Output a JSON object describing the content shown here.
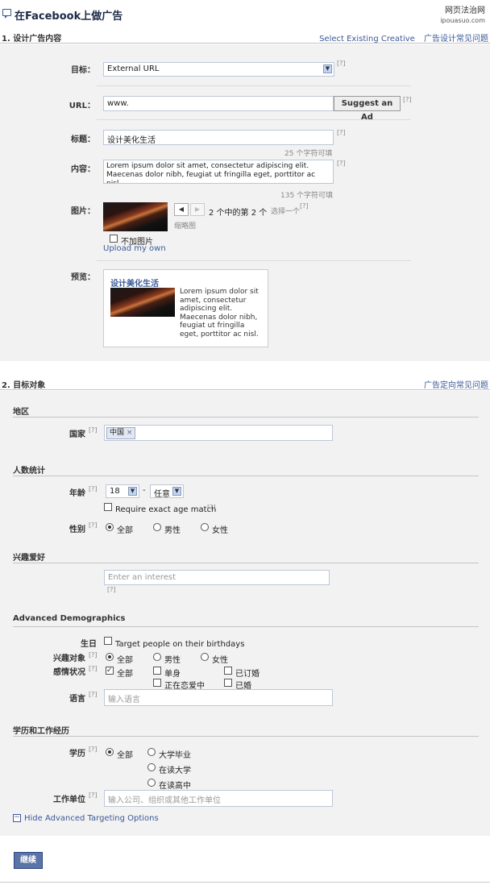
{
  "header": {
    "title": "在Facebook上做广告",
    "watermark_line1": "网页法治网",
    "watermark_line2": "ipouasuo.com"
  },
  "section1": {
    "title": "1. 设计广告内容",
    "link_existing": "Select Existing Creative",
    "link_faq": "广告设计常见问题",
    "target_label": "目标：",
    "target_value": "External URL",
    "help": "[?]",
    "url_label": "URL：",
    "url_value": "www.",
    "suggest_button": "Suggest an Ad",
    "title_label": "标题：",
    "title_value": "设计美化生活",
    "title_remaining": "25 个字符可填",
    "body_label": "内容：",
    "body_value": "Lorem ipsum dolor sit amet, consectetur adipiscing elit. Maecenas dolor nibh, feugiat ut fringilla eget, porttitor ac nisl.",
    "body_remaining": "135 个字符可填",
    "image_label": "图片：",
    "image_counter": "2 个中的第 2 个",
    "image_choose": "选择一个",
    "thumbnail_label": "缩略图",
    "no_image_label": "不加图片",
    "upload_link": "Upload my own",
    "preview_label": "预览：",
    "preview_title": "设计美化生活",
    "preview_body": "Lorem ipsum dolor sit amet, consectetur adipiscing elit. Maecenas dolor nibh, feugiat ut fringilla eget, porttitor ac nisl."
  },
  "section2": {
    "title": "2. 目标对象",
    "link_faq": "广告定向常见问题",
    "location_head": "地区",
    "country_label": "国家",
    "country_token": "中国",
    "demo_head": "人数统计",
    "age_label": "年龄",
    "age_min": "18",
    "age_dash": "-",
    "age_max": "任意",
    "exact_age": "Require exact age match",
    "sex_label": "性别",
    "sex_all": "全部",
    "sex_male": "男性",
    "sex_female": "女性",
    "interest_head": "兴趣爱好",
    "interest_placeholder": "Enter an interest",
    "adv_head": "Advanced Demographics",
    "birthday_label": "生日",
    "birthday_option": "Target people on their birthdays",
    "interested_label": "兴趣对象",
    "int_all": "全部",
    "int_male": "男性",
    "int_female": "女性",
    "rel_label": "感情状况",
    "rel_all": "全部",
    "rel_single": "单身",
    "rel_engaged": "已订婚",
    "rel_relationship": "正在恋爱中",
    "rel_married": "已婚",
    "lang_label": "语言",
    "lang_placeholder": "输入语言",
    "edu_head": "学历和工作经历",
    "edu_label": "学历",
    "edu_all": "全部",
    "edu_grad": "大学毕业",
    "edu_college": "在读大学",
    "edu_hs": "在读高中",
    "work_label": "工作单位",
    "work_placeholder": "输入公司、组织或其他工作单位",
    "hide_adv": "Hide Advanced Targeting Options"
  },
  "footer": {
    "continue_button": "继续"
  }
}
